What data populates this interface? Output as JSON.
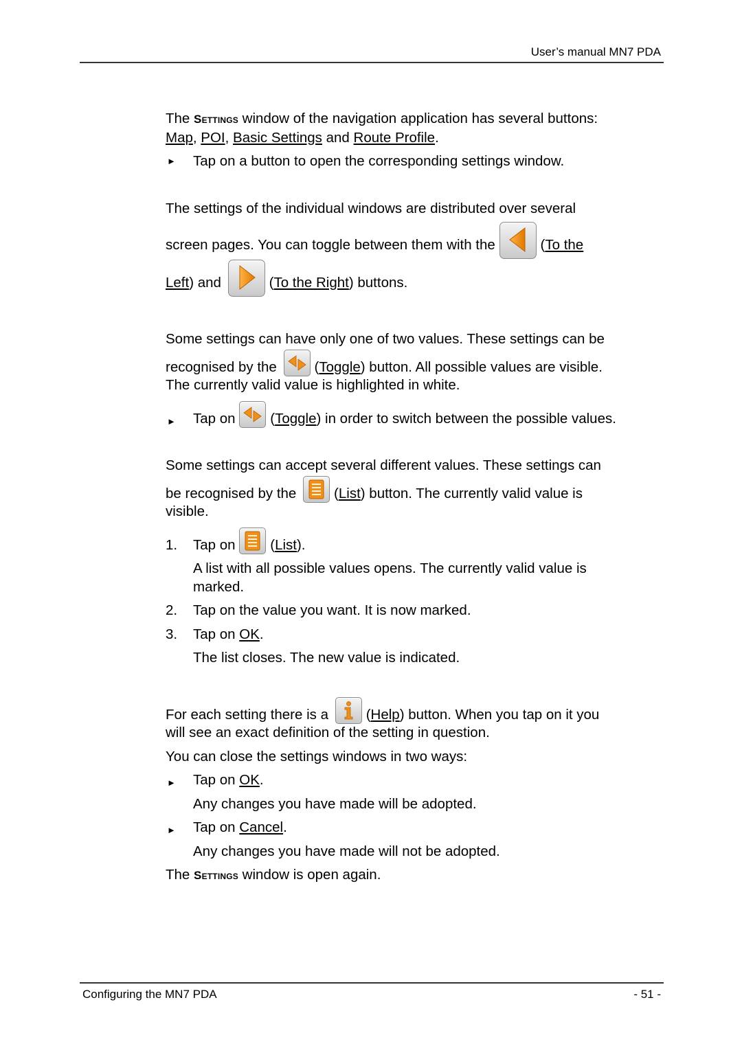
{
  "header": {
    "title": "User’s manual MN7 PDA"
  },
  "footer": {
    "section": "Configuring the MN7 PDA",
    "page": "- 51 -"
  },
  "p1": {
    "t1": "The ",
    "settings": "Settings",
    "t2": " window of the navigation application has several buttons:",
    "map": "Map",
    "c1": ", ",
    "poi": "POI",
    "c2": ", ",
    "basic": "Basic Settings",
    "and": " and ",
    "route": "Route Profile",
    "end": "."
  },
  "b1": "Tap on a button to open the corresponding settings window.",
  "p2": {
    "line1": "The settings of the individual windows are distributed over several",
    "t1": "screen pages. You can toggle between them with the ",
    "left_a": "(",
    "left_link1": "To the",
    "left_link2": "Left",
    "and": ") and ",
    "right_a": "(",
    "right_link": "To the Right",
    "right_b": ") buttons."
  },
  "p3": {
    "line1": "Some settings can have only one of two values. These settings can be",
    "t1": "recognised by the ",
    "toggle": "Toggle",
    "t2": ") button. All possible values are visible.",
    "line3": "The currently valid value is highlighted in white."
  },
  "b2": {
    "t1": "Tap on ",
    "toggle": "Toggle",
    "t2": ") in order to switch between the possible values."
  },
  "p4": {
    "line1": "Some settings can accept several different values. These settings can",
    "t1": "be recognised by the ",
    "list": "List",
    "t2": ") button. The currently valid value is",
    "line3": "visible."
  },
  "steps": [
    {
      "num": "1.",
      "t1": "Tap on ",
      "link": "List",
      "t2": ").",
      "note": "A list with all possible values opens. The currently valid value is marked."
    },
    {
      "num": "2.",
      "text": "Tap on the value you want. It is now marked."
    },
    {
      "num": "3.",
      "t1": "Tap on ",
      "link": "OK",
      "t2": ".",
      "note": "The list closes. The new value is indicated."
    }
  ],
  "p5": {
    "t1": "For each setting there is a ",
    "help": "Help",
    "t2": ") button. When you tap on it you",
    "line2": "will see an exact definition of the setting in question."
  },
  "p6": "You can close the settings windows in two ways:",
  "close_opts": [
    {
      "t1": "Tap on ",
      "link": "OK",
      "t2": ".",
      "note": "Any changes you have made will be adopted."
    },
    {
      "t1": "Tap on ",
      "link": "Cancel",
      "t2": ".",
      "note": "Any changes you have made will not be adopted."
    }
  ],
  "p7": {
    "t1": "The ",
    "settings": "Settings",
    "t2": " window is open again."
  },
  "icons": {
    "left": "arrow-left-icon",
    "right": "arrow-right-icon",
    "toggle": "toggle-icon",
    "list": "list-icon",
    "help": "info-icon",
    "bullet": "►"
  },
  "colors": {
    "accent_orange": "#f0901a",
    "button_grey": "#d4d4d4"
  }
}
